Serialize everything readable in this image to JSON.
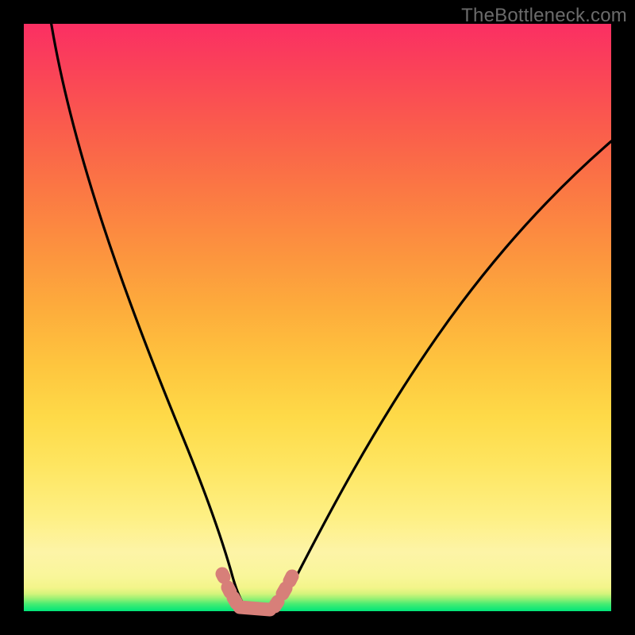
{
  "watermark": "TheBottleneck.com",
  "colors": {
    "frame": "#000000",
    "curve_stroke": "#000000",
    "marker_fill": "#d77f79",
    "gradient_top": "#fb2f63",
    "gradient_bottom": "#00e579"
  },
  "chart_data": {
    "type": "line",
    "title": "",
    "xlabel": "",
    "ylabel": "",
    "xlim": [
      0,
      100
    ],
    "ylim": [
      0,
      100
    ],
    "series": [
      {
        "name": "left-branch-curve",
        "x": [
          4,
          10,
          15,
          20,
          25,
          28,
          30,
          32,
          33.5,
          34.5,
          35,
          35.5,
          36,
          36.5,
          37
        ],
        "y": [
          100,
          75,
          57,
          42,
          28,
          20,
          14.5,
          9.5,
          6,
          4,
          2.8,
          1.8,
          1.0,
          0.5,
          0.2
        ],
        "note": "y in percent of plot height from bottom (0 = bottom green, 100 = top red). No axis ticks visible; values estimated from pixel positions."
      },
      {
        "name": "right-branch-curve",
        "x": [
          42,
          43,
          44,
          45,
          46,
          48,
          52,
          58,
          66,
          76,
          88,
          100
        ],
        "y": [
          0.2,
          1.2,
          2.5,
          4,
          6,
          10,
          17,
          27,
          40,
          54,
          68,
          80
        ],
        "note": "same scale as left branch"
      },
      {
        "name": "valley-floor",
        "x": [
          37,
          38,
          39,
          40,
          41,
          42
        ],
        "y": [
          0.2,
          0.05,
          0.02,
          0.02,
          0.05,
          0.2
        ]
      }
    ],
    "markers": [
      {
        "group": "left-cluster",
        "points": [
          [
            33.8,
            6.2
          ],
          [
            34.6,
            3.8
          ],
          [
            35.6,
            1.8
          ]
        ]
      },
      {
        "group": "valley-cluster",
        "points": [
          [
            36.5,
            0.7
          ],
          [
            38.0,
            0.35
          ],
          [
            39.5,
            0.3
          ],
          [
            41.0,
            0.4
          ],
          [
            42.0,
            0.7
          ]
        ]
      },
      {
        "group": "right-cluster",
        "points": [
          [
            43.2,
            1.8
          ],
          [
            44.4,
            3.4
          ],
          [
            45.4,
            5.4
          ]
        ]
      }
    ],
    "marker_style": {
      "shape": "rounded-pill",
      "approx_radius_px": 8
    }
  }
}
